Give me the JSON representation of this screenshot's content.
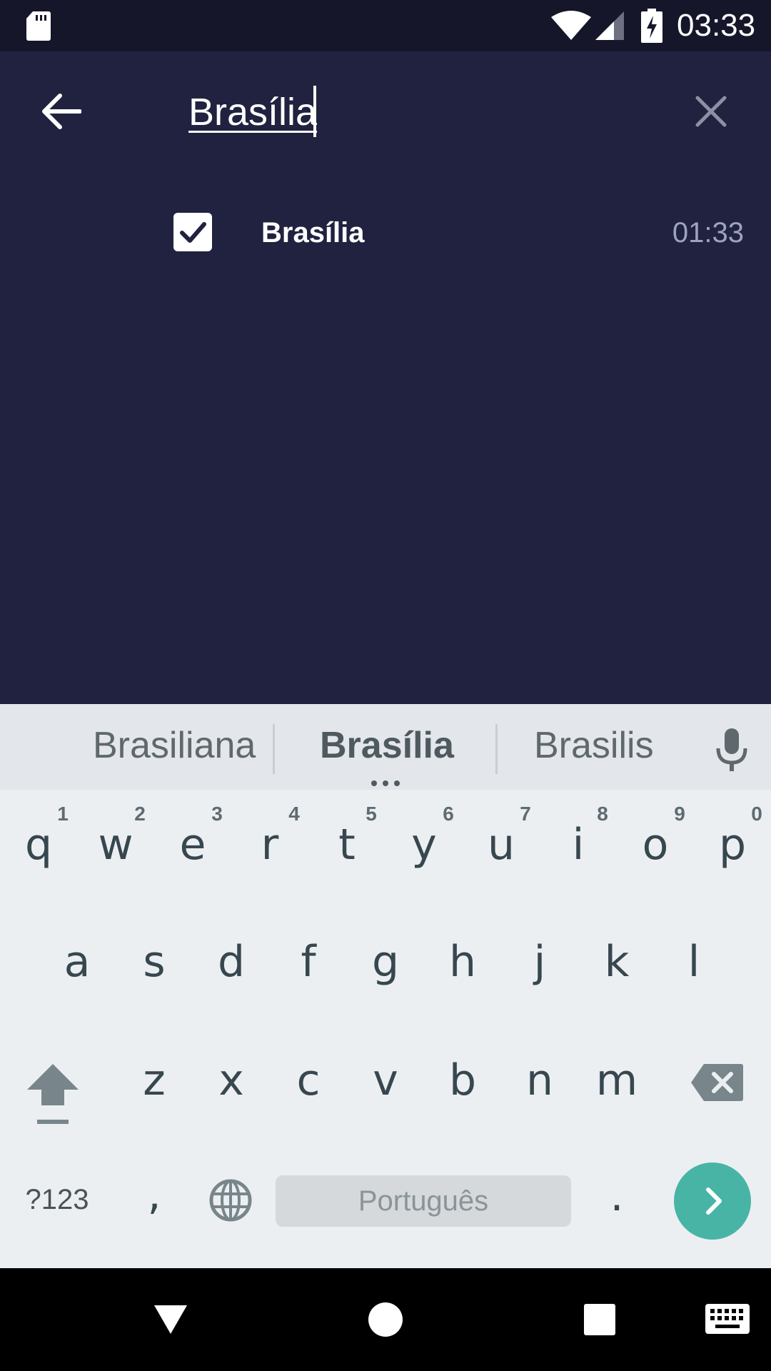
{
  "status_bar": {
    "time": "03:33"
  },
  "search": {
    "query": "Brasília"
  },
  "results": [
    {
      "name": "Brasília",
      "time": "01:33",
      "checked": true
    }
  ],
  "keyboard": {
    "suggestions": [
      "Brasiliana",
      "Brasília",
      "Brasilis"
    ],
    "row1": [
      {
        "key": "q",
        "hint": "1"
      },
      {
        "key": "w",
        "hint": "2"
      },
      {
        "key": "e",
        "hint": "3"
      },
      {
        "key": "r",
        "hint": "4"
      },
      {
        "key": "t",
        "hint": "5"
      },
      {
        "key": "y",
        "hint": "6"
      },
      {
        "key": "u",
        "hint": "7"
      },
      {
        "key": "i",
        "hint": "8"
      },
      {
        "key": "o",
        "hint": "9"
      },
      {
        "key": "p",
        "hint": "0"
      }
    ],
    "row2": [
      "a",
      "s",
      "d",
      "f",
      "g",
      "h",
      "j",
      "k",
      "l"
    ],
    "row3": [
      "z",
      "x",
      "c",
      "v",
      "b",
      "n",
      "m"
    ],
    "symbols_label": "?123",
    "comma": ",",
    "period": ".",
    "space_label": "Português"
  },
  "colors": {
    "background": "#20223F",
    "accent": "#48B4A5"
  },
  "icons": [
    "sd-card-icon",
    "wifi-icon",
    "signal-icon",
    "battery-charging-icon",
    "back-arrow-icon",
    "close-icon",
    "checkbox-checked-icon",
    "mic-icon",
    "shift-icon",
    "backspace-icon",
    "globe-icon",
    "next-icon",
    "nav-back-icon",
    "nav-home-icon",
    "nav-recents-icon",
    "keyboard-icon"
  ]
}
